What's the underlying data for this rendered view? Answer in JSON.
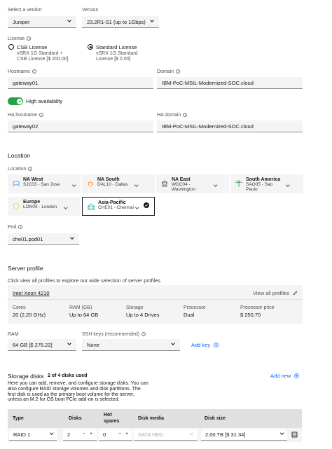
{
  "vendor": {
    "label": "Select a vendor",
    "value": "Juniper"
  },
  "version": {
    "label": "Version",
    "value": "23.2R1-S1 (up to 1Gbps)"
  },
  "license": {
    "label": "License",
    "options": [
      {
        "title": "CSB License",
        "line1": "vSRX 1G Standard +",
        "line2": "CSB License [$ 200.00]",
        "selected": false
      },
      {
        "title": "Standard License",
        "line1": "vSRX 1G Standard",
        "line2": "License [$ 0.00]",
        "selected": true
      }
    ]
  },
  "hostname": {
    "label": "Hostname",
    "value": "gateway01"
  },
  "domain": {
    "label": "Domain",
    "value": "IBM-PoC-MSIL-Modernized-SOC.cloud"
  },
  "high_availability": {
    "label": "High availability",
    "on": true
  },
  "ha_hostname": {
    "label": "HA hostname",
    "value": "gateway02"
  },
  "ha_domain": {
    "label": "HA domain",
    "value": "IBM-PoC-MSIL-Modernized-SOC.cloud"
  },
  "location": {
    "heading": "Location",
    "label": "Location",
    "tiles": [
      {
        "name": "NA West",
        "sub": "SJC03 - San Jose",
        "sub2": "",
        "selected": false
      },
      {
        "name": "NA South",
        "sub": "DAL10 - Dallas",
        "sub2": "",
        "selected": false
      },
      {
        "name": "NA East",
        "sub": "WDC04 -",
        "sub2": "Washington",
        "selected": false
      },
      {
        "name": "South America",
        "sub": "SAO05 - Sao",
        "sub2": "Paulo",
        "selected": false
      },
      {
        "name": "Europe",
        "sub": "LON04 - London",
        "sub2": "",
        "selected": false
      },
      {
        "name": "Asia-Pacific",
        "sub": "CHE01 - Chennai",
        "sub2": "",
        "selected": true
      }
    ]
  },
  "pod": {
    "label": "Pod",
    "value": "che01.pod01"
  },
  "server_profile": {
    "heading": "Server profile",
    "description": "Click view all profiles to explore our wide selection of server profiles.",
    "name": "Intel Xeon 4210",
    "view_all": "View all profiles",
    "specs": [
      {
        "label": "Cores",
        "value": "20 (2.20 GHz)"
      },
      {
        "label": "RAM (GB)",
        "value": "Up to 64 GB"
      },
      {
        "label": "Storage",
        "value": "Up to 4 Drives"
      },
      {
        "label": "Processor",
        "value": "Dual"
      },
      {
        "label": "Processor price",
        "value": "$ 250.70"
      }
    ]
  },
  "ram": {
    "label": "RAM",
    "value": "64 GB [$ 276.22]"
  },
  "ssh": {
    "label": "SSH keys (recommended)",
    "value": "None",
    "add_key": "Add key"
  },
  "storage": {
    "heading": "Storage disks",
    "count": "2 of 4 disks used",
    "add_new": "Add new",
    "description": [
      "Here you can add, remove, and configure storage disks. You can",
      "also configure RAID storage volumes and disk partitions. The",
      "first disk is used as the primary boot volume for the server,",
      "unless an M.2 for OS boot PCIe add-on is selected."
    ],
    "columns": [
      "Type",
      "Disks",
      "Hot",
      "spares",
      "Disk media",
      "Disk size"
    ],
    "row": {
      "type": "RAID 1",
      "disks": "2",
      "hot_spares": "0",
      "media": "SATA HDD",
      "size": "2.00 TB [$ 31.34]"
    }
  },
  "colors": {
    "accent": "#0f62fe",
    "toggle_on": "#24a148",
    "field_bg": "#f4f4f4"
  }
}
